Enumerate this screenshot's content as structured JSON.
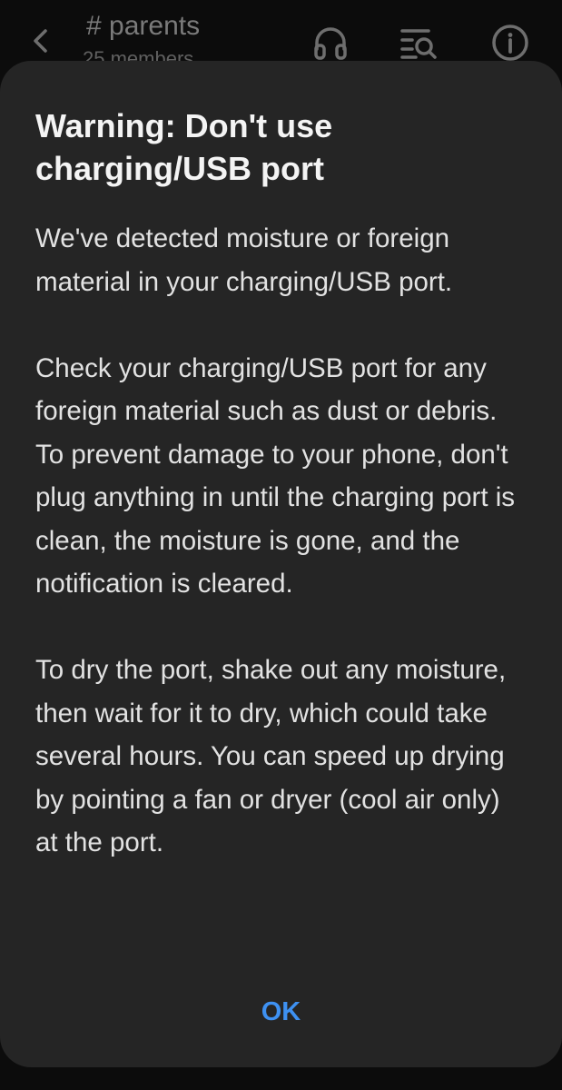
{
  "app_header": {
    "channel_name": "# parents",
    "member_count": "25 members"
  },
  "dialog": {
    "title": "Warning: Don't use charging/USB port",
    "paragraphs": [
      "We've detected moisture or foreign material in your charging/USB port.",
      "Check your charging/USB port for any foreign material such as dust or debris. To prevent damage to your phone, don't plug anything in until the charging port is clean, the moisture is gone, and the notification is cleared.",
      "To dry the port, shake out any moisture, then wait for it to dry, which could take several hours. You can speed up drying by pointing a fan or dryer (cool air only) at the port."
    ],
    "ok_label": "OK"
  },
  "colors": {
    "background": "#0c0c0c",
    "dialog_bg": "#252525",
    "title_text": "#f4f4f4",
    "body_text": "#e2e2e2",
    "accent": "#3e91f2"
  },
  "icons": [
    "back-arrow-icon",
    "headphones-icon",
    "search-list-icon",
    "info-icon"
  ]
}
